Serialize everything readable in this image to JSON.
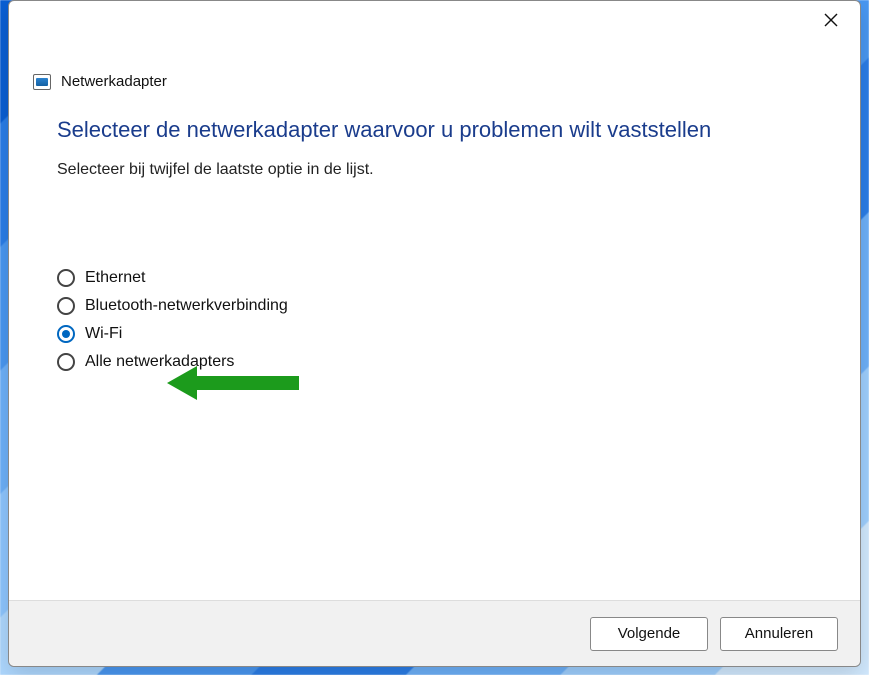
{
  "window": {
    "title": "Netwerkadapter"
  },
  "content": {
    "heading": "Selecteer de netwerkadapter waarvoor u problemen wilt vaststellen",
    "subtext": "Selecteer bij twijfel de laatste optie in de lijst."
  },
  "options": [
    {
      "label": "Ethernet",
      "selected": false
    },
    {
      "label": "Bluetooth-netwerkverbinding",
      "selected": false
    },
    {
      "label": "Wi-Fi",
      "selected": true
    },
    {
      "label": "Alle netwerkadapters",
      "selected": false
    }
  ],
  "footer": {
    "next": "Volgende",
    "cancel": "Annuleren"
  },
  "annotation": {
    "arrow_color": "#1c9b1c"
  }
}
